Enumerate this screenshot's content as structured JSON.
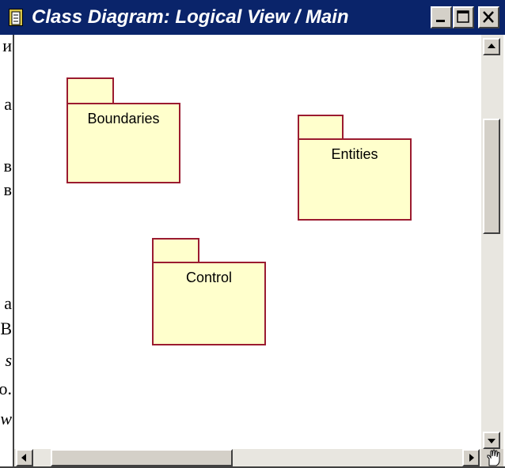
{
  "window": {
    "title": "Class Diagram: Logical View / Main",
    "title_icon": "class-diagram-icon",
    "controls": [
      {
        "name": "minimize",
        "icon": "minimize-icon"
      },
      {
        "name": "maximize",
        "icon": "maximize-icon"
      },
      {
        "name": "close",
        "icon": "close-icon"
      }
    ]
  },
  "background_document": {
    "visible_fragments": [
      "и",
      "а",
      "в",
      "в",
      "а",
      "В",
      "s",
      "о.",
      "w"
    ]
  },
  "diagram": {
    "packages": [
      {
        "name": "Boundaries"
      },
      {
        "name": "Entities"
      },
      {
        "name": "Control"
      }
    ]
  },
  "scrollbars": {
    "corner_icon": "hand-cursor-icon"
  },
  "colors": {
    "titlebar": "#0a246a",
    "package_fill": "#ffffcc",
    "package_border": "#9b1b30",
    "chrome": "#d4d0c8"
  }
}
